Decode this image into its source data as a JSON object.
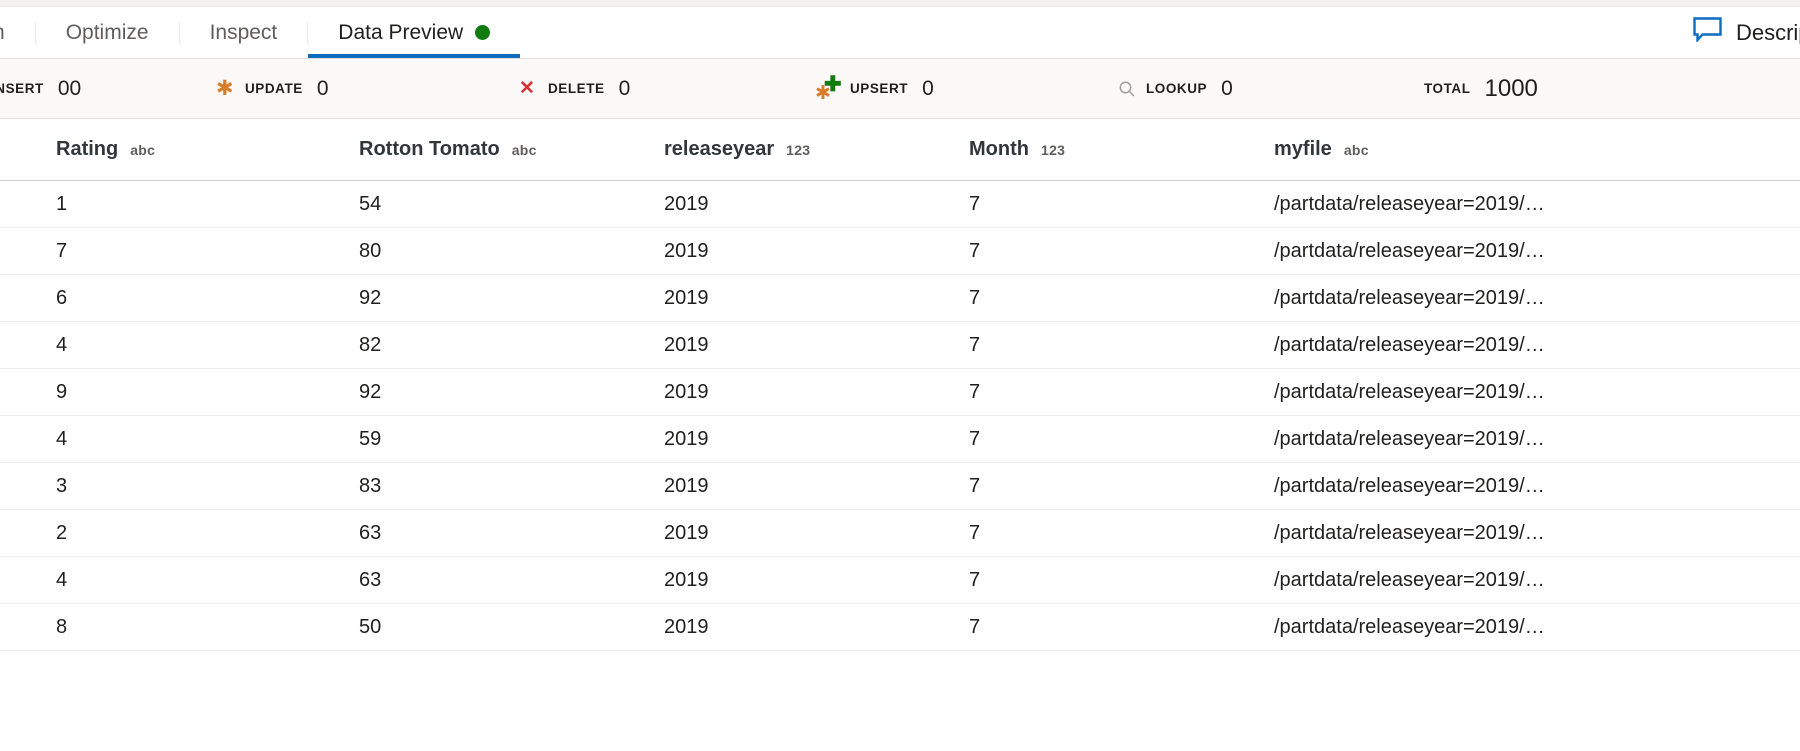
{
  "tabs": [
    {
      "label": "jection",
      "active": false,
      "truncated_left": true
    },
    {
      "label": "Optimize",
      "active": false
    },
    {
      "label": "Inspect",
      "active": false
    },
    {
      "label": "Data Preview",
      "active": true,
      "dot": "status-dot-green"
    }
  ],
  "tabbar_right": {
    "label": "Description",
    "icon": "comment-icon",
    "icon_color": "#0f6cbd"
  },
  "stats": [
    {
      "id": "insert",
      "label": "INSERT",
      "value": "00",
      "icon": "insert-icon",
      "truncated": true
    },
    {
      "id": "update",
      "label": "UPDATE",
      "value": "0",
      "icon": "asterisk-icon",
      "icon_color": "#d87c2a"
    },
    {
      "id": "delete",
      "label": "DELETE",
      "value": "0",
      "icon": "x-icon",
      "icon_color": "#d13438"
    },
    {
      "id": "upsert",
      "label": "UPSERT",
      "value": "0",
      "icon": "asterisk-plus-icon",
      "icon_color": "#107c10"
    },
    {
      "id": "lookup",
      "label": "LOOKUP",
      "value": "0",
      "icon": "search-icon",
      "icon_color": "#a19f9d"
    },
    {
      "id": "total",
      "label": "TOTAL",
      "value": "1000",
      "icon": "none"
    }
  ],
  "grid": {
    "columns": [
      {
        "name": "Rating",
        "type": "abc"
      },
      {
        "name": "Rotton Tomato",
        "type": "abc"
      },
      {
        "name": "releaseyear",
        "type": "123"
      },
      {
        "name": "Month",
        "type": "123"
      },
      {
        "name": "myfile",
        "type": "abc"
      }
    ],
    "rows": [
      [
        "1",
        "54",
        "2019",
        "7",
        "/partdata/releaseyear=2019/…"
      ],
      [
        "7",
        "80",
        "2019",
        "7",
        "/partdata/releaseyear=2019/…"
      ],
      [
        "6",
        "92",
        "2019",
        "7",
        "/partdata/releaseyear=2019/…"
      ],
      [
        "4",
        "82",
        "2019",
        "7",
        "/partdata/releaseyear=2019/…"
      ],
      [
        "9",
        "92",
        "2019",
        "7",
        "/partdata/releaseyear=2019/…"
      ],
      [
        "4",
        "59",
        "2019",
        "7",
        "/partdata/releaseyear=2019/…"
      ],
      [
        "3",
        "83",
        "2019",
        "7",
        "/partdata/releaseyear=2019/…"
      ],
      [
        "2",
        "63",
        "2019",
        "7",
        "/partdata/releaseyear=2019/…"
      ],
      [
        "4",
        "63",
        "2019",
        "7",
        "/partdata/releaseyear=2019/…"
      ],
      [
        "8",
        "50",
        "2019",
        "7",
        "/partdata/releaseyear=2019/…"
      ]
    ]
  },
  "colors": {
    "accent": "#0f6cbd",
    "status_green": "#107c10",
    "warning_orange": "#d87c2a",
    "error_red": "#d13438",
    "stats_bg": "#faf9f8"
  }
}
